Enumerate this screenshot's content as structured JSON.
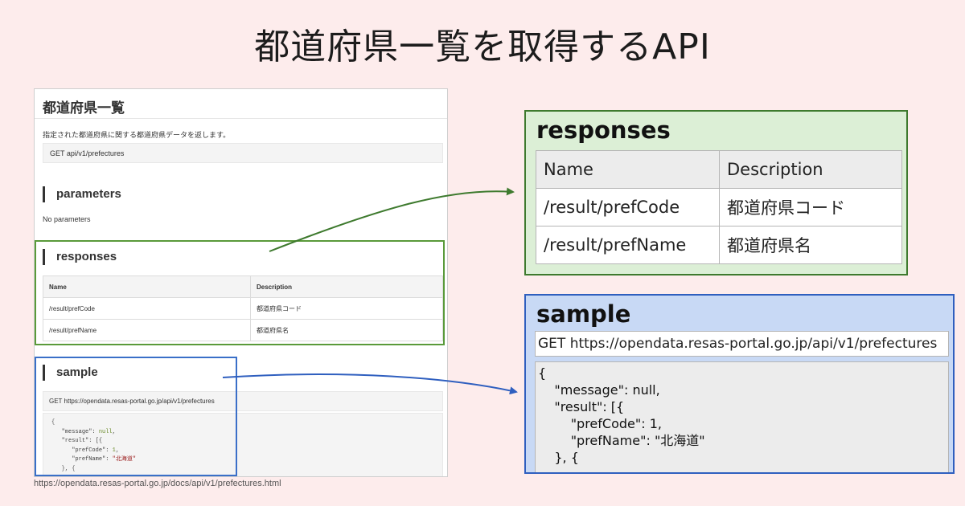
{
  "slide": {
    "title": "都道府県一覧を取得するAPI",
    "source_url": "https://opendata.resas-portal.go.jp/docs/api/v1/prefectures.html"
  },
  "screenshot": {
    "heading": "都道府県一覧",
    "description": "指定された都道府県に関する都道府県データを返します。",
    "endpoint": "GET  api/v1/prefectures",
    "parameters_heading": "parameters",
    "no_parameters": "No parameters",
    "responses_heading": "responses",
    "table_headers": [
      "Name",
      "Description"
    ],
    "table_rows": [
      [
        "/result/prefCode",
        "都道府県コード"
      ],
      [
        "/result/prefName",
        "都道府県名"
      ]
    ],
    "sample_heading": "sample",
    "sample_get": "GET https://opendata.resas-portal.go.jp/api/v1/prefectures",
    "code": {
      "l1": "{",
      "l2_key": "\"message\": ",
      "l2_val": "null",
      "l2_end": ",",
      "l3": "\"result\": [{",
      "l4_key": "\"prefCode\": ",
      "l4_val": "1",
      "l4_end": ",",
      "l5_key": "\"prefName\": ",
      "l5_val": "\"北海道\"",
      "l6": "}, {"
    }
  },
  "responses_callout": {
    "title": "responses",
    "headers": [
      "Name",
      "Description"
    ],
    "rows": [
      [
        "/result/prefCode",
        "都道府県コード"
      ],
      [
        "/result/prefName",
        "都道府県名"
      ]
    ]
  },
  "sample_callout": {
    "title": "sample",
    "get_line": "GET https://opendata.resas-portal.go.jp/api/v1/prefectures",
    "code_lines": [
      "{",
      "    \"message\": null,",
      "    \"result\": [{",
      "        \"prefCode\": 1,",
      "        \"prefName\": \"北海道\"",
      "    }, {"
    ]
  },
  "colors": {
    "background": "#fdecec",
    "responses_accent": "#3e7a2e",
    "sample_accent": "#2f5fbf"
  }
}
